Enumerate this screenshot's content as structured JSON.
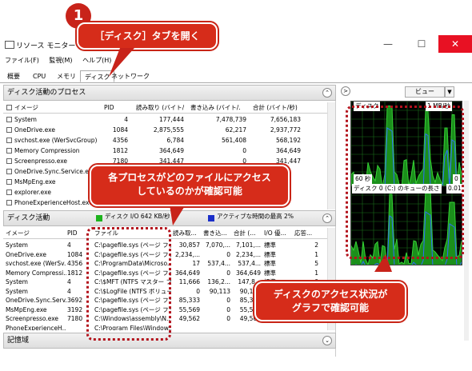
{
  "callouts": {
    "step_number": "1",
    "step_text": "［ディスク］タブを開く",
    "file_access_line1": "各プロセスがどのファイルにアクセス",
    "file_access_line2": "しているのかが確認可能",
    "graph_line1": "ディスクのアクセス状況が",
    "graph_line2": "グラフで確認可能"
  },
  "window": {
    "title": "リソース モニター",
    "minimize": "—",
    "maximize": "☐",
    "close": "✕"
  },
  "menu": [
    "ファイル(F)",
    "監視(M)",
    "ヘルプ(H)"
  ],
  "tabs": [
    "概要",
    "CPU",
    "メモリ",
    "ディスク",
    "ネットワーク"
  ],
  "processes": {
    "title": "ディスク活動のプロセス",
    "columns": [
      "イメージ",
      "PID",
      "読み取り (バイト/...",
      "書き込み (バイト/...",
      "合計 (バイト/秒)"
    ],
    "rows": [
      [
        "System",
        "4",
        "177,444",
        "7,478,739",
        "7,656,183"
      ],
      [
        "OneDrive.exe",
        "1084",
        "2,875,555",
        "62,217",
        "2,937,772"
      ],
      [
        "svchost.exe (WerSvcGroup)",
        "4356",
        "6,784",
        "561,408",
        "568,192"
      ],
      [
        "Memory Compression",
        "1812",
        "364,649",
        "0",
        "364,649"
      ],
      [
        "Screenpresso.exe",
        "7180",
        "341,447",
        "0",
        "341,447"
      ],
      [
        "OneDrive.Sync.Service.exe",
        "",
        "",
        "",
        ""
      ],
      [
        "MsMpEng.exe",
        "",
        "",
        "",
        ""
      ],
      [
        "explorer.exe",
        "",
        "",
        "",
        ""
      ],
      [
        "PhoneExperienceHost.exe",
        "",
        "",
        "",
        ""
      ]
    ]
  },
  "disk_activity": {
    "title": "ディスク活動",
    "io_legend": "ディスク I/O 642 KB/秒",
    "io_color": "#1db31d",
    "active_legend": "アクティブな時間の最高 2%",
    "active_color": "#1b2fc9",
    "columns": [
      "イメージ",
      "PID",
      "ファイル",
      "読み取...",
      "書き込...",
      "合計 (...",
      "I/O 優...",
      "応答..."
    ],
    "rows": [
      [
        "System",
        "4",
        "C:\\pagefile.sys (ページ ファ...",
        "30,857",
        "7,070,...",
        "7,101,...",
        "標準",
        "2"
      ],
      [
        "OneDrive.exe",
        "1084",
        "C:\\pagefile.sys (ページ ファ...",
        "2,234,...",
        "0",
        "2,234,...",
        "標準",
        "1"
      ],
      [
        "svchost.exe (WerSv...",
        "4356",
        "C:\\ProgramData\\Microso...",
        "17",
        "537,4...",
        "537,4...",
        "標準",
        "5"
      ],
      [
        "Memory Compressi...",
        "1812",
        "C:\\pagefile.sys (ページ ファ...",
        "364,649",
        "0",
        "364,649",
        "標準",
        "1"
      ],
      [
        "System",
        "4",
        "C:\\$MFT (NTFS マスター ファ...",
        "11,666",
        "136,2...",
        "147,8...",
        "標準",
        "0"
      ],
      [
        "System",
        "4",
        "C:\\$LogFile (NTFS ボリュー...",
        "0",
        "90,113",
        "90,113",
        "標準",
        "0"
      ],
      [
        "OneDrive.Sync.Serv...",
        "3692",
        "C:\\pagefile.sys (ページ ファ...",
        "85,333",
        "0",
        "85,333",
        "標準",
        "0"
      ],
      [
        "MsMpEng.exe",
        "3192",
        "C:\\pagefile.sys (ページ ファ...",
        "55,569",
        "0",
        "55,569",
        "標準",
        "0"
      ],
      [
        "Screenpresso.exe",
        "7180",
        "C:\\Windows\\assembly\\N...",
        "49,562",
        "0",
        "49,562",
        "標準",
        "0"
      ],
      [
        "PhoneExperienceH...",
        "",
        "C:\\Program Files\\Window...",
        "",
        "",
        "",
        "",
        ""
      ]
    ]
  },
  "storage": {
    "title": "記憶域"
  },
  "right": {
    "view_label": "ビュー",
    "disk_graph": {
      "label": "ディスク",
      "scale": "1 MB/秒",
      "time": "60 秒",
      "zero": "0"
    },
    "queue_graph": {
      "label": "ディスク 0 (C:) のキューの長さ",
      "scale": "0.01"
    }
  }
}
